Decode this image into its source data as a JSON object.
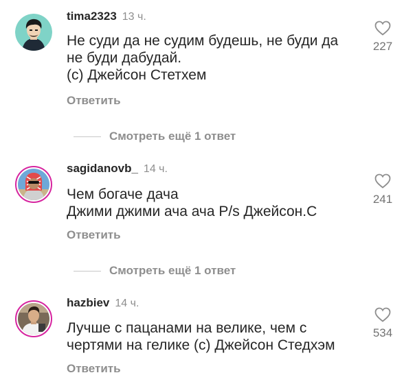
{
  "comments": [
    {
      "username": "tima2323",
      "time": "13 ч.",
      "lines": [
        "Не суди да не судим будешь, не буди да",
        "не буди дабудай.",
        "(с) Джейсон Стетхем"
      ],
      "reply_label": "Ответить",
      "likes": "227"
    },
    {
      "username": "sagidanovb_",
      "time": "14 ч.",
      "lines": [
        "Чем богаче дача",
        "Джими джими ача ача P/s Джейсон.С"
      ],
      "reply_label": "Ответить",
      "likes": "241"
    },
    {
      "username": "hazbiev",
      "time": "14 ч.",
      "lines": [
        "Лучше с пацанами на велике, чем с",
        "чертями на гелике (с) Джейсон Стедхэм"
      ],
      "reply_label": "Ответить",
      "likes": "534"
    }
  ],
  "view_more": [
    "Смотреть ещё 1 ответ",
    "Смотреть ещё 1 ответ"
  ],
  "colors": {
    "text": "#262626",
    "secondary": "#8e8e8e",
    "story_ring": "#d6249f"
  },
  "icons": {
    "like": "heart-outline-icon"
  }
}
